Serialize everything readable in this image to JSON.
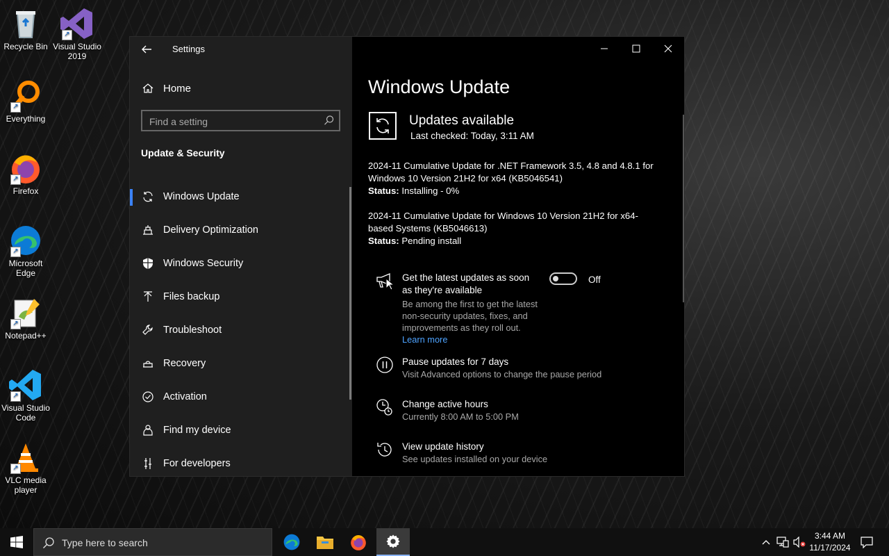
{
  "desktop": {
    "icons": [
      {
        "label": "Recycle Bin"
      },
      {
        "label": "Visual Studio 2019"
      },
      {
        "label": "Everything"
      },
      {
        "label": "Firefox"
      },
      {
        "label": "Microsoft Edge"
      },
      {
        "label": "Notepad++"
      },
      {
        "label": "Visual Studio Code"
      },
      {
        "label": "VLC media player"
      }
    ]
  },
  "window": {
    "title": "Settings",
    "back_icon": "back-arrow-icon"
  },
  "sidebar": {
    "home_label": "Home",
    "search_placeholder": "Find a setting",
    "section_title": "Update & Security",
    "items": [
      {
        "label": "Windows Update",
        "icon": "sync-icon",
        "active": true
      },
      {
        "label": "Delivery Optimization",
        "icon": "delivery-icon"
      },
      {
        "label": "Windows Security",
        "icon": "shield-icon"
      },
      {
        "label": "Files backup",
        "icon": "backup-arrow-icon"
      },
      {
        "label": "Troubleshoot",
        "icon": "wrench-icon"
      },
      {
        "label": "Recovery",
        "icon": "recovery-icon"
      },
      {
        "label": "Activation",
        "icon": "check-circle-icon"
      },
      {
        "label": "Find my device",
        "icon": "person-location-icon"
      },
      {
        "label": "For developers",
        "icon": "developer-tools-icon"
      }
    ]
  },
  "main": {
    "page_title": "Windows Update",
    "status_heading": "Updates available",
    "last_checked": "Last checked: Today, 3:11 AM",
    "updates": [
      {
        "name": "2024-11 Cumulative Update for .NET Framework 3.5, 4.8 and 4.8.1 for Windows 10 Version 21H2 for x64 (KB5046541)",
        "status_label": "Status:",
        "status_value": " Installing - 0%"
      },
      {
        "name": "2024-11 Cumulative Update for Windows 10 Version 21H2 for x64-based Systems (KB5046613)",
        "status_label": "Status:",
        "status_value": " Pending install"
      }
    ],
    "latest_updates": {
      "title": "Get the latest updates as soon as they're available",
      "desc": "Be among the first to get the latest non-security updates, fixes, and improvements as they roll out.",
      "link": "Learn more",
      "toggle_label": "Off",
      "toggle_on": false
    },
    "options": [
      {
        "title": "Pause updates for 7 days",
        "desc": "Visit Advanced options to change the pause period",
        "icon": "pause-icon"
      },
      {
        "title": "Change active hours",
        "desc": "Currently 8:00 AM to 5:00 PM",
        "icon": "active-hours-clock-icon"
      },
      {
        "title": "View update history",
        "desc": "See updates installed on your device",
        "icon": "history-icon"
      }
    ]
  },
  "taskbar": {
    "search_placeholder": "Type here to search",
    "time": "3:44 AM",
    "date": "11/17/2024"
  }
}
